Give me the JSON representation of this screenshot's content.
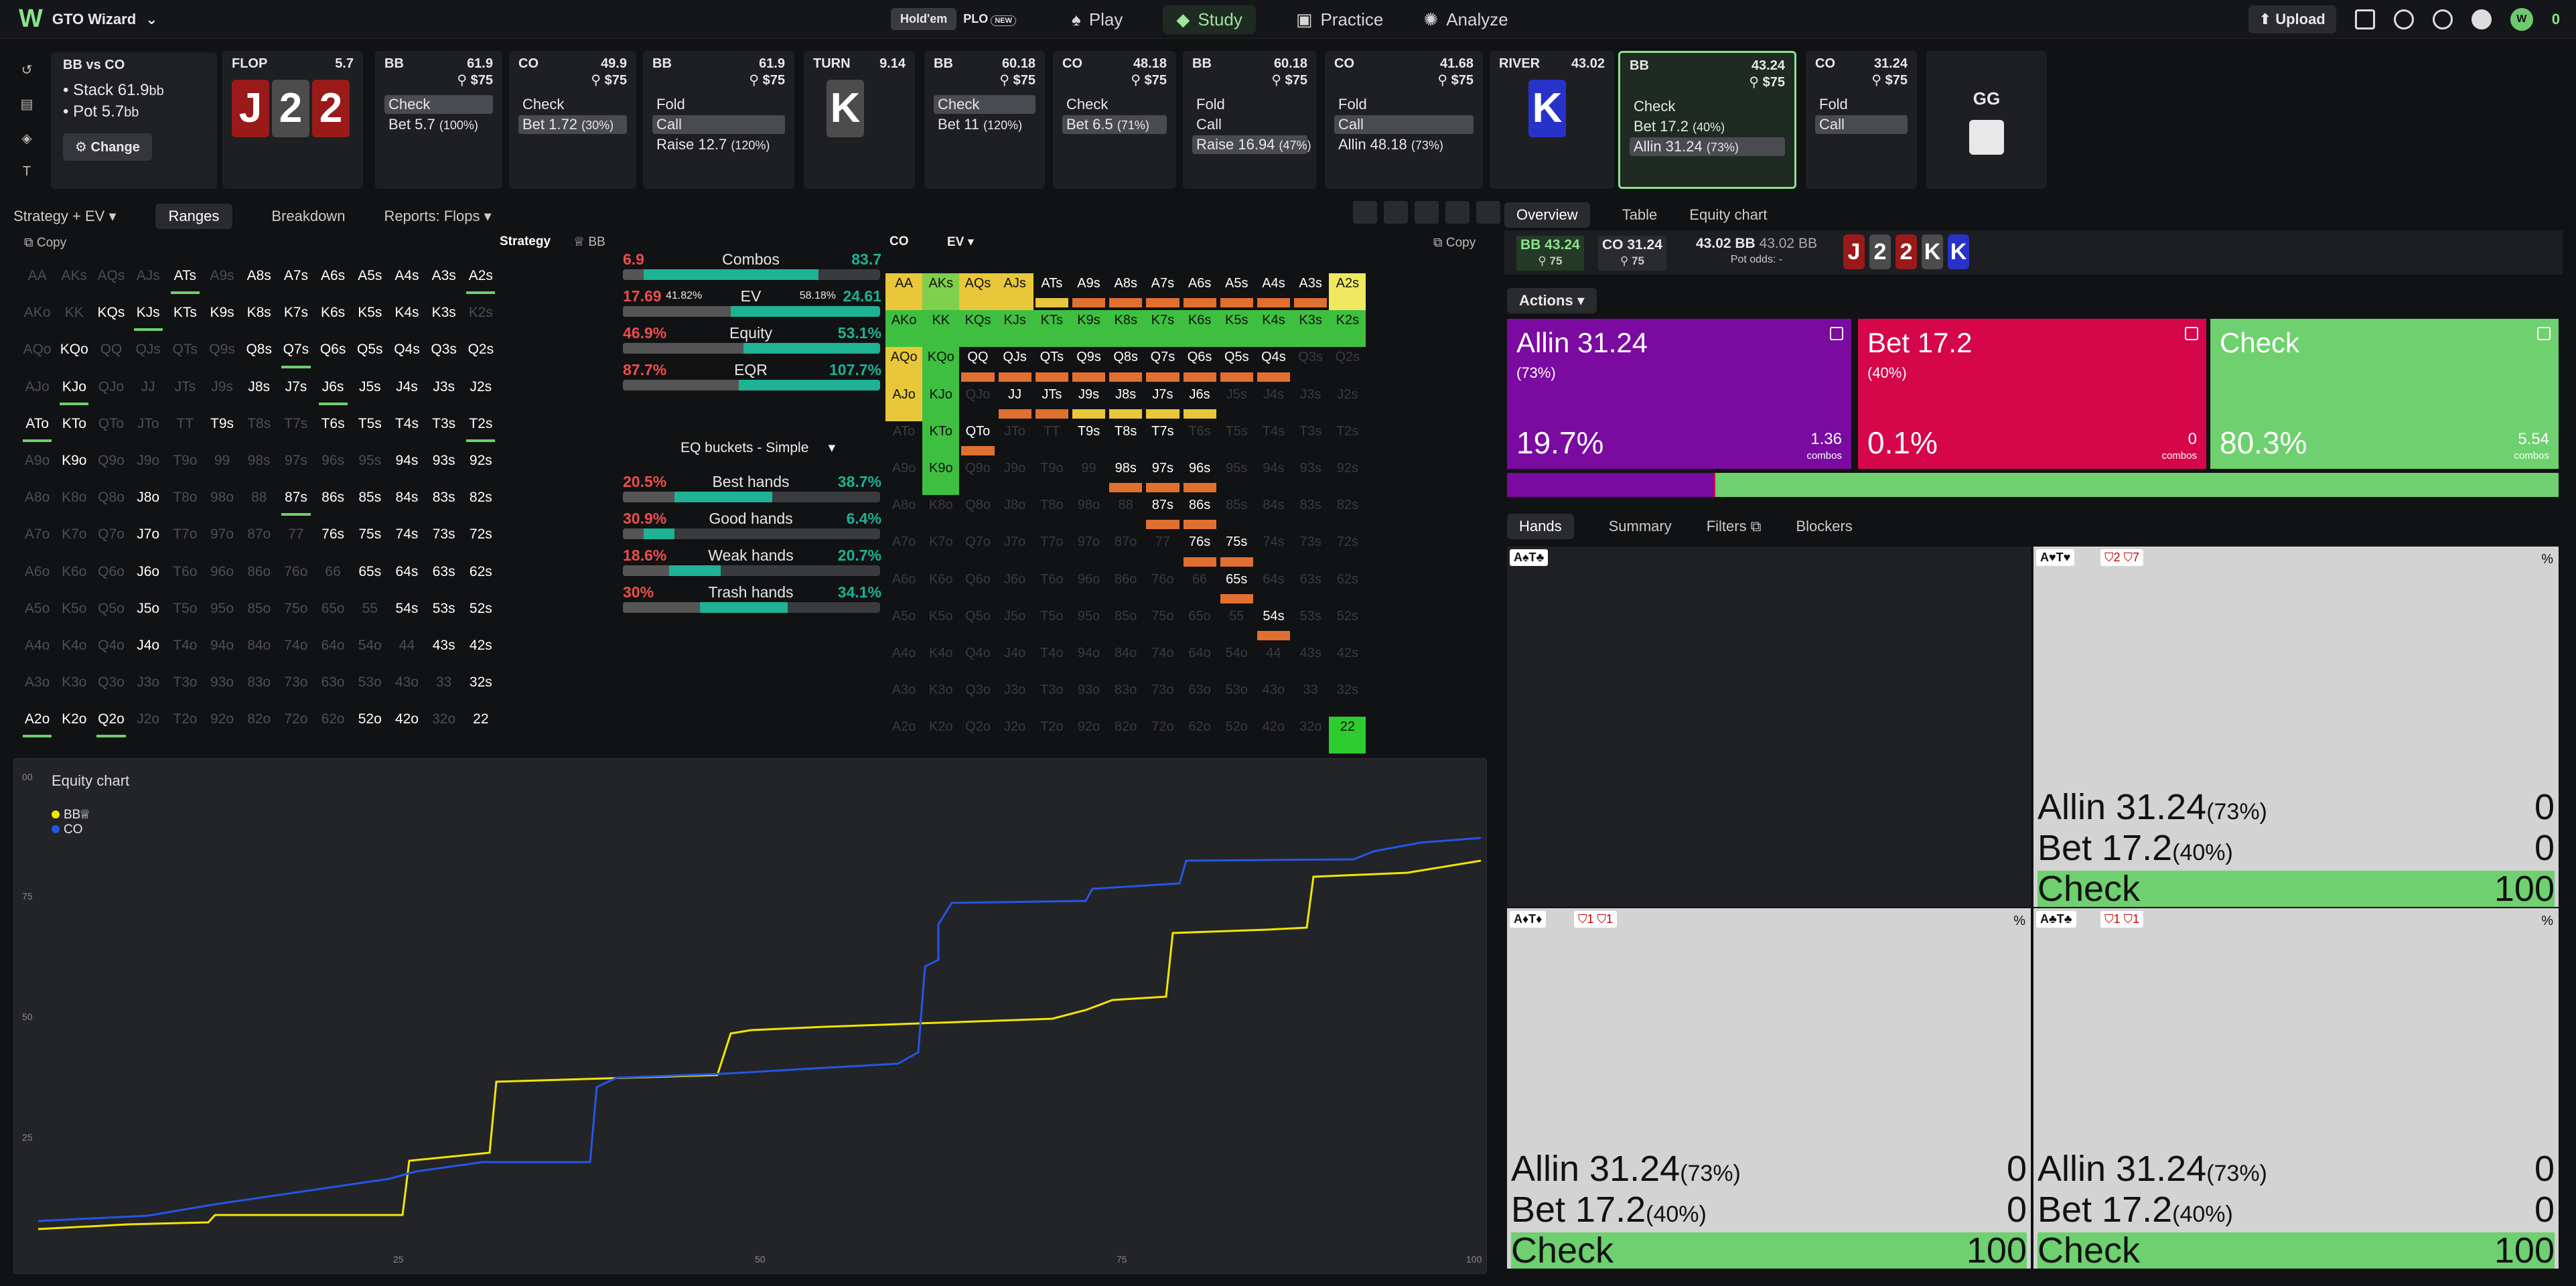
{
  "app": {
    "name": "GTO Wizard",
    "variants": [
      "Hold'em",
      "PLO"
    ],
    "new_badge": "NEW",
    "nav": [
      "Play",
      "Study",
      "Practice",
      "Analyze"
    ],
    "upload": "Upload",
    "balance": "0"
  },
  "spot": {
    "title": "BB vs CO",
    "stack": "• Stack 61.9",
    "stack_unit": "bb",
    "pot": "• Pot 5.7",
    "pot_unit": "bb",
    "change": "Change"
  },
  "flop": {
    "label": "FLOP",
    "pot": "5.7",
    "cards": [
      "J",
      "2",
      "2"
    ]
  },
  "turn": {
    "label": "TURN",
    "pot": "9.14",
    "card": "K"
  },
  "river": {
    "label": "RIVER",
    "pot": "43.02",
    "card": "K"
  },
  "nodes": [
    {
      "player": "BB",
      "stack": "61.9",
      "pot": "$75",
      "opts": [
        {
          "t": "Check",
          "sel": true
        },
        {
          "t": "Bet 5.7",
          "f": "(100%)"
        }
      ]
    },
    {
      "player": "CO",
      "stack": "49.9",
      "pot": "$75",
      "opts": [
        {
          "t": "Check"
        },
        {
          "t": "Bet 1.72",
          "f": "(30%)",
          "sel": true
        }
      ]
    },
    {
      "player": "BB",
      "stack": "61.9",
      "pot": "$75",
      "opts": [
        {
          "t": "Fold"
        },
        {
          "t": "Call",
          "sel": true
        },
        {
          "t": "Raise 12.7",
          "f": "(120%)"
        }
      ]
    },
    {
      "player": "BB",
      "stack": "60.18",
      "pot": "$75",
      "opts": [
        {
          "t": "Check",
          "sel": true
        },
        {
          "t": "Bet 11",
          "f": "(120%)"
        }
      ]
    },
    {
      "player": "CO",
      "stack": "48.18",
      "pot": "$75",
      "opts": [
        {
          "t": "Check"
        },
        {
          "t": "Bet 6.5",
          "f": "(71%)",
          "sel": true
        }
      ]
    },
    {
      "player": "BB",
      "stack": "60.18",
      "pot": "$75",
      "opts": [
        {
          "t": "Fold"
        },
        {
          "t": "Call"
        },
        {
          "t": "Raise 16.94",
          "f": "(47%)",
          "sel": true
        }
      ]
    },
    {
      "player": "CO",
      "stack": "41.68",
      "pot": "$75",
      "opts": [
        {
          "t": "Fold"
        },
        {
          "t": "Call",
          "sel": true
        },
        {
          "t": "Allin 48.18",
          "f": "(73%)"
        }
      ]
    },
    {
      "player": "BB",
      "stack": "43.24",
      "pot": "$75",
      "opts": [
        {
          "t": "Check"
        },
        {
          "t": "Bet 17.2",
          "f": "(40%)"
        },
        {
          "t": "Allin 31.24",
          "f": "(73%)",
          "sel": true
        }
      ]
    },
    {
      "player": "CO",
      "stack": "31.24",
      "pot": "$75",
      "opts": [
        {
          "t": "Fold"
        },
        {
          "t": "Call",
          "sel": true
        }
      ]
    }
  ],
  "gg": {
    "label": "GG"
  },
  "tabs": [
    "Strategy + EV",
    "Ranges",
    "Breakdown",
    "Reports: Flops"
  ],
  "left_range": {
    "copy": "Copy",
    "strategy": "Strategy",
    "player": "BB"
  },
  "stats": [
    {
      "l": "6.9",
      "n": "Combos",
      "r": "83.7"
    },
    {
      "l": "17.69",
      "l2": "41.82%",
      "n": "EV",
      "r2": "58.18%",
      "r": "24.61"
    },
    {
      "l": "46.9%",
      "n": "Equity",
      "r": "53.1%"
    },
    {
      "l": "87.7%",
      "n": "EQR",
      "r": "107.7%"
    }
  ],
  "eq_buckets_title": "EQ buckets - Simple",
  "buckets": [
    {
      "l": "20.5%",
      "n": "Best hands",
      "r": "38.7%"
    },
    {
      "l": "30.9%",
      "n": "Good hands",
      "r": "6.4%"
    },
    {
      "l": "18.6%",
      "n": "Weak hands",
      "r": "20.7%"
    },
    {
      "l": "30%",
      "n": "Trash hands",
      "r": "34.1%"
    }
  ],
  "right_range": {
    "player": "CO",
    "mode": "EV",
    "copy": "Copy"
  },
  "hands": [
    "AA",
    "AKs",
    "AQs",
    "AJs",
    "ATs",
    "A9s",
    "A8s",
    "A7s",
    "A6s",
    "A5s",
    "A4s",
    "A3s",
    "A2s",
    "AKo",
    "KK",
    "KQs",
    "KJs",
    "KTs",
    "K9s",
    "K8s",
    "K7s",
    "K6s",
    "K5s",
    "K4s",
    "K3s",
    "K2s",
    "AQo",
    "KQo",
    "QQ",
    "QJs",
    "QTs",
    "Q9s",
    "Q8s",
    "Q7s",
    "Q6s",
    "Q5s",
    "Q4s",
    "Q3s",
    "Q2s",
    "AJo",
    "KJo",
    "QJo",
    "JJ",
    "JTs",
    "J9s",
    "J8s",
    "J7s",
    "J6s",
    "J5s",
    "J4s",
    "J3s",
    "J2s",
    "ATo",
    "KTo",
    "QTo",
    "JTo",
    "TT",
    "T9s",
    "T8s",
    "T7s",
    "T6s",
    "T5s",
    "T4s",
    "T3s",
    "T2s",
    "A9o",
    "K9o",
    "Q9o",
    "J9o",
    "T9o",
    "99",
    "98s",
    "97s",
    "96s",
    "95s",
    "94s",
    "93s",
    "92s",
    "A8o",
    "K8o",
    "Q8o",
    "J8o",
    "T8o",
    "98o",
    "88",
    "87s",
    "86s",
    "85s",
    "84s",
    "83s",
    "82s",
    "A7o",
    "K7o",
    "Q7o",
    "J7o",
    "T7o",
    "97o",
    "87o",
    "77",
    "76s",
    "75s",
    "74s",
    "73s",
    "72s",
    "A6o",
    "K6o",
    "Q6o",
    "J6o",
    "T6o",
    "96o",
    "86o",
    "76o",
    "66",
    "65s",
    "64s",
    "63s",
    "62s",
    "A5o",
    "K5o",
    "Q5o",
    "J5o",
    "T5o",
    "95o",
    "85o",
    "75o",
    "65o",
    "55",
    "54s",
    "53s",
    "52s",
    "A4o",
    "K4o",
    "Q4o",
    "J4o",
    "T4o",
    "94o",
    "84o",
    "74o",
    "64o",
    "54o",
    "44",
    "43s",
    "42s",
    "A3o",
    "K3o",
    "Q3o",
    "J3o",
    "T3o",
    "93o",
    "83o",
    "73o",
    "63o",
    "53o",
    "43o",
    "33",
    "32s",
    "A2o",
    "K2o",
    "Q2o",
    "J2o",
    "T2o",
    "92o",
    "82o",
    "72o",
    "62o",
    "52o",
    "42o",
    "32o",
    "22"
  ],
  "equity_chart": {
    "title": "Equity chart",
    "legend": [
      "BB",
      "CO"
    ],
    "y_ticks": [
      "00",
      "75",
      "50",
      "25"
    ],
    "x_ticks": [
      "25",
      "50",
      "75",
      "100"
    ]
  },
  "right_tabs": [
    "Overview",
    "Table",
    "Equity chart"
  ],
  "infobar": {
    "bb": "BB 43.24",
    "bb_sub": "75",
    "co": "CO 31.24",
    "co_sub": "75",
    "pot": "43.02 BB",
    "pot2": "43.02 BB",
    "odds": "Pot odds:",
    "odds_v": "-",
    "board": [
      "J",
      "2",
      "2",
      "K",
      "K"
    ]
  },
  "actions_btn": "Actions",
  "action_boxes": [
    {
      "name": "Allin 31.24",
      "pct": "(73%)",
      "freq": "19.7%",
      "combos": "1.36",
      "color": "#7a0aa0",
      "f": 0.197
    },
    {
      "name": "Bet 17.2",
      "pct": "(40%)",
      "freq": "0.1%",
      "combos": "0",
      "color": "#d6064a",
      "f": 0.001
    },
    {
      "name": "Check",
      "pct": "",
      "freq": "80.3%",
      "combos": "5.54",
      "color": "#6ed06e",
      "f": 0.803
    }
  ],
  "combos_word": "combos",
  "hand_tabs": [
    "Hands",
    "Summary",
    "Filters",
    "Blockers"
  ],
  "hand_cards": [
    {
      "lbl": "A♠T♣",
      "dark": true
    },
    {
      "lbl": "A♥T♥",
      "b1": "2",
      "b2": "7",
      "rows": [
        {
          "n": "Allin 31.24",
          "p": "(73%)",
          "v": "0"
        },
        {
          "n": "Bet 17.2",
          "p": "(40%)",
          "v": "0"
        },
        {
          "n": "Check",
          "p": "",
          "v": "100"
        }
      ]
    },
    {
      "lbl": "A♦T♦",
      "b1": "1",
      "b2": "1",
      "rows": [
        {
          "n": "Allin 31.24",
          "p": "(73%)",
          "v": "0"
        },
        {
          "n": "Bet 17.2",
          "p": "(40%)",
          "v": "0"
        },
        {
          "n": "Check",
          "p": "",
          "v": "100"
        }
      ]
    },
    {
      "lbl": "A♣T♣",
      "b1": "1",
      "b2": "1",
      "rows": [
        {
          "n": "Allin 31.24",
          "p": "(73%)",
          "v": "0"
        },
        {
          "n": "Bet 17.2",
          "p": "(40%)",
          "v": "0"
        },
        {
          "n": "Check",
          "p": "",
          "v": "100"
        }
      ]
    }
  ],
  "pct_sign": "%"
}
